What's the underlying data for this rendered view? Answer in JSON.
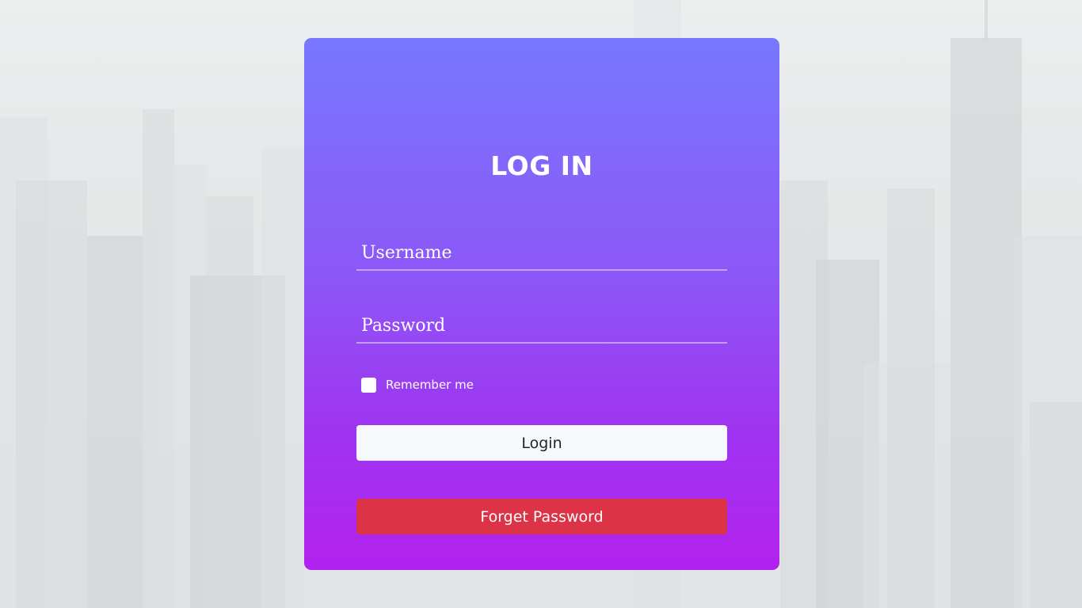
{
  "login_form": {
    "title": "LOG IN",
    "username_placeholder": "Username",
    "password_placeholder": "Password",
    "remember_label": "Remember me",
    "remember_checked": false,
    "login_button": "Login",
    "forgot_button": "Forget Password"
  },
  "colors": {
    "card_gradient_top": "#7778ff",
    "card_gradient_bottom": "#b222ee",
    "login_button_bg": "#f7f8fa",
    "forgot_button_bg": "#dc3446",
    "text": "#ffffff"
  }
}
